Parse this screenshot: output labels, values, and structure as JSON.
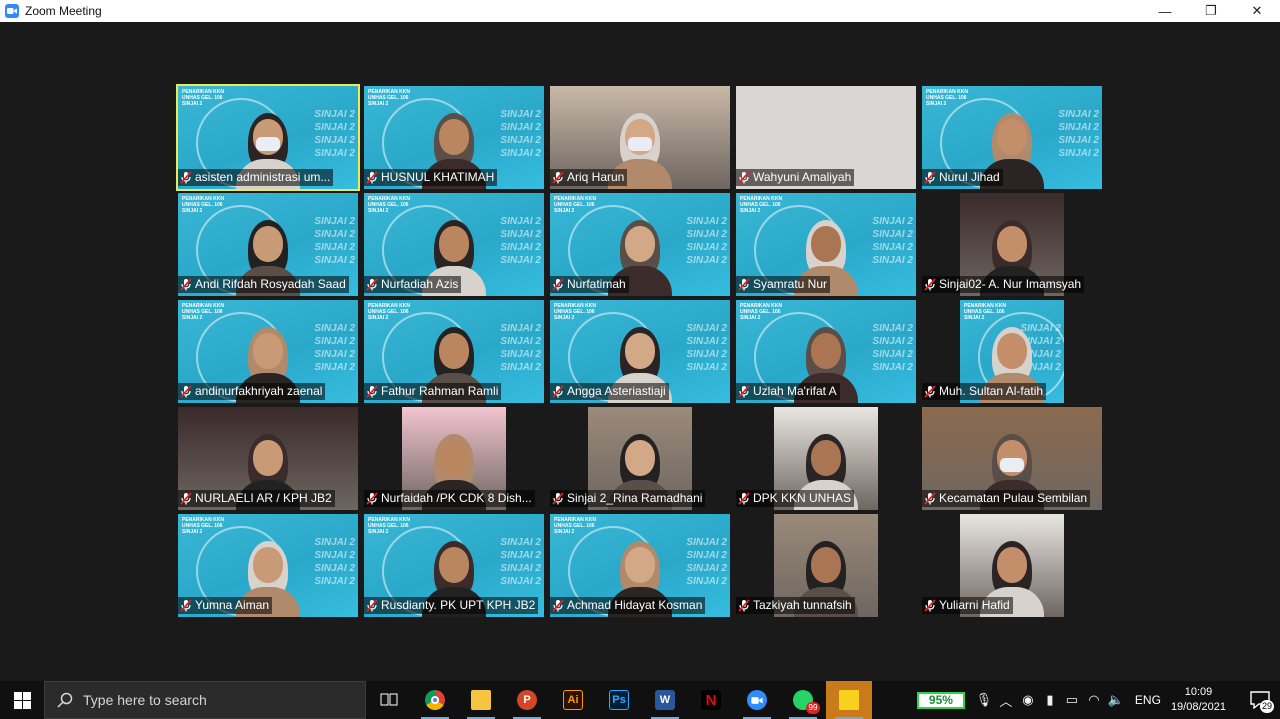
{
  "window": {
    "title": "Zoom Meeting",
    "minimize": "—",
    "maximize": "❐",
    "close": "✕"
  },
  "banner": {
    "header": "PENARIKAN KKN\nUNHAS GEL. 106\nSINJAI 2",
    "watermark": "SINJAI 2\nSINJAI 2\nSINJAI 2\nSINJAI 2"
  },
  "participants": [
    {
      "name": "asisten administrasi um...",
      "video": "banner",
      "active": true
    },
    {
      "name": "HUSNUL KHATIMAH",
      "video": "banner"
    },
    {
      "name": "Ariq Harun",
      "video": "camera"
    },
    {
      "name": "Wahyuni Amaliyah",
      "video": "blank"
    },
    {
      "name": "Nurul Jihad",
      "video": "banner"
    },
    {
      "name": "Andi Rifdah Rosyadah Saad",
      "video": "banner"
    },
    {
      "name": "Nurfadiah Azis",
      "video": "banner"
    },
    {
      "name": "Nurfatimah",
      "video": "banner"
    },
    {
      "name": "Syamratu Nur",
      "video": "banner"
    },
    {
      "name": "Sinjai02- A. Nur Imamsyah",
      "video": "camera-narrow"
    },
    {
      "name": "andinurfakhriyah zaenal",
      "video": "banner"
    },
    {
      "name": "Fathur Rahman Ramli",
      "video": "banner"
    },
    {
      "name": "Angga Asteriastiaji",
      "video": "banner"
    },
    {
      "name": "Uzlah Ma'rifat A",
      "video": "banner"
    },
    {
      "name": "Muh. Sultan Al-fatih",
      "video": "banner-narrow"
    },
    {
      "name": "NURLAELI AR / KPH JB2",
      "video": "camera"
    },
    {
      "name": "Nurfaidah  /PK CDK 8 Dish...",
      "video": "camera-narrow"
    },
    {
      "name": "Sinjai 2_Rina Ramadhani",
      "video": "camera-narrow"
    },
    {
      "name": "DPK KKN UNHAS",
      "video": "camera-narrow"
    },
    {
      "name": "Kecamatan Pulau Sembilan",
      "video": "camera"
    },
    {
      "name": "Yumna Aiman",
      "video": "banner"
    },
    {
      "name": "Rusdianty. PK UPT KPH JB2",
      "video": "banner"
    },
    {
      "name": "Achmad Hidayat Kosman",
      "video": "banner"
    },
    {
      "name": "Tazkiyah tunnafsih",
      "video": "camera-narrow"
    },
    {
      "name": "Yuliarni Hafid",
      "video": "camera-narrow"
    }
  ],
  "taskbar": {
    "search_placeholder": "Type here to search",
    "apps": [
      {
        "icon": "task-view-icon"
      },
      {
        "icon": "chrome-icon"
      },
      {
        "icon": "file-explorer-icon"
      },
      {
        "icon": "powerpoint-icon",
        "label": "P"
      },
      {
        "icon": "illustrator-icon",
        "label": "Ai"
      },
      {
        "icon": "photoshop-icon",
        "label": "Ps"
      },
      {
        "icon": "word-icon",
        "label": "W"
      },
      {
        "icon": "netflix-icon",
        "label": "N"
      },
      {
        "icon": "zoom-icon"
      },
      {
        "icon": "whatsapp-icon",
        "badge": "99"
      },
      {
        "icon": "sticky-notes-icon"
      }
    ],
    "battery": "95%",
    "language": "ENG",
    "time": "10:09",
    "date": "19/08/2021",
    "notifications": "29"
  },
  "colors": {
    "banner": "#3ab7d6",
    "active_speaker": "#e6eb5a",
    "muted_mic": "#e02424",
    "zoom_blue": "#2d8cff"
  }
}
